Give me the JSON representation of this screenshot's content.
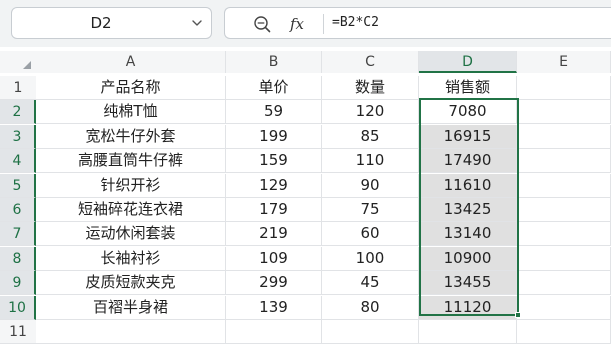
{
  "name_box": {
    "value": "D2"
  },
  "formula_bar": {
    "formula": "=B2*C2",
    "fx_label": "fx"
  },
  "columns": [
    "A",
    "B",
    "C",
    "D",
    "E"
  ],
  "selected_column": "D",
  "rows": [
    {
      "row": "1",
      "cells": [
        "产品名称",
        "单价",
        "数量",
        "销售额",
        ""
      ]
    },
    {
      "row": "2",
      "cells": [
        "纯棉T恤",
        "59",
        "120",
        "7080",
        ""
      ]
    },
    {
      "row": "3",
      "cells": [
        "宽松牛仔外套",
        "199",
        "85",
        "16915",
        ""
      ]
    },
    {
      "row": "4",
      "cells": [
        "高腰直筒牛仔裤",
        "159",
        "110",
        "17490",
        ""
      ]
    },
    {
      "row": "5",
      "cells": [
        "针织开衫",
        "129",
        "90",
        "11610",
        ""
      ]
    },
    {
      "row": "6",
      "cells": [
        "短袖碎花连衣裙",
        "179",
        "75",
        "13425",
        ""
      ]
    },
    {
      "row": "7",
      "cells": [
        "运动休闲套装",
        "219",
        "60",
        "13140",
        ""
      ]
    },
    {
      "row": "8",
      "cells": [
        "长袖衬衫",
        "109",
        "100",
        "10900",
        ""
      ]
    },
    {
      "row": "9",
      "cells": [
        "皮质短款夹克",
        "299",
        "45",
        "13455",
        ""
      ]
    },
    {
      "row": "10",
      "cells": [
        "百褶半身裙",
        "139",
        "80",
        "11120",
        ""
      ]
    },
    {
      "row": "11",
      "cells": [
        "",
        "",
        "",
        "",
        ""
      ]
    }
  ],
  "selected_range": "D2:D10",
  "colors": {
    "accent": "#217346",
    "range_fill": "#e0e0e0",
    "header_bg": "#f5f6f7"
  }
}
